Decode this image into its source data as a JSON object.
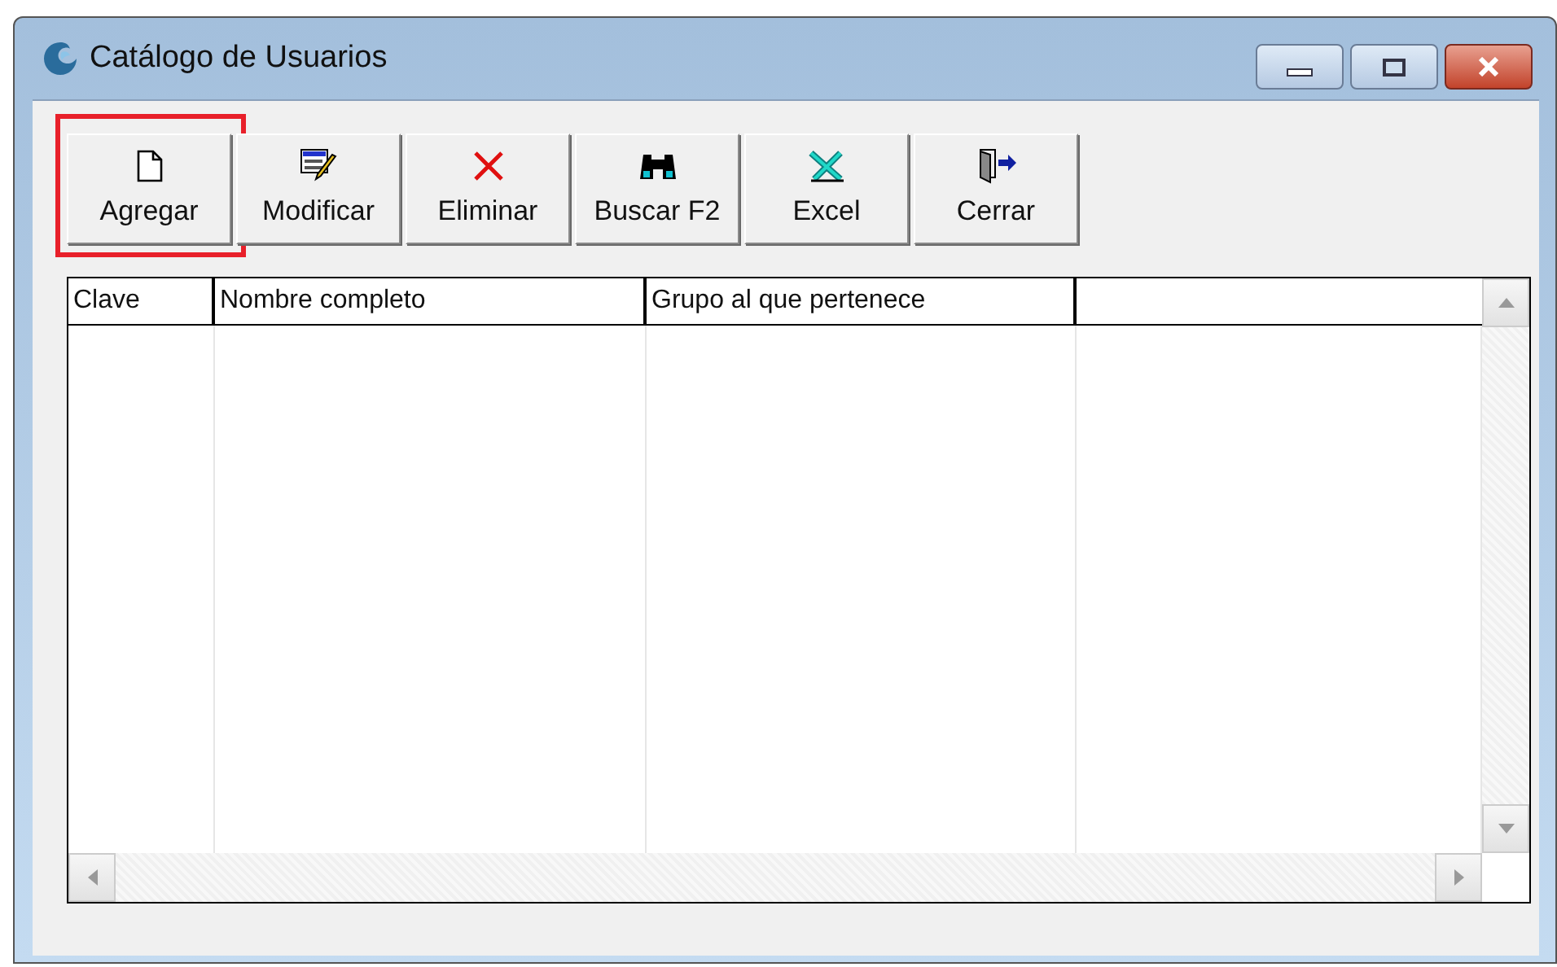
{
  "window": {
    "title": "Catálogo de Usuarios"
  },
  "toolbar": [
    {
      "kind": "new",
      "label": "Agregar",
      "highlighted": true
    },
    {
      "kind": "edit",
      "label": "Modificar",
      "highlighted": false
    },
    {
      "kind": "delete",
      "label": "Eliminar",
      "highlighted": false
    },
    {
      "kind": "find",
      "label": "Buscar F2",
      "highlighted": false
    },
    {
      "kind": "excel",
      "label": "Excel",
      "highlighted": false
    },
    {
      "kind": "exit",
      "label": "Cerrar",
      "highlighted": false
    }
  ],
  "table": {
    "columns": [
      "Clave",
      "Nombre completo",
      "Grupo al que pertenece"
    ]
  }
}
